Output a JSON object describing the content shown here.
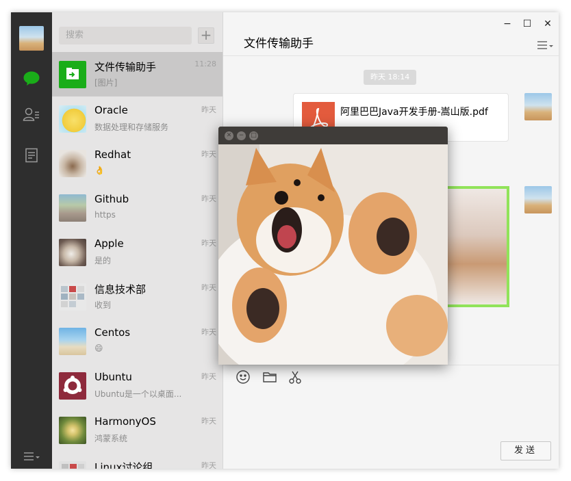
{
  "search": {
    "placeholder": "搜索"
  },
  "plus_label": "+",
  "chats": [
    {
      "name": "文件传输助手",
      "time": "11:28",
      "preview": "[图片]"
    },
    {
      "name": "Oracle",
      "time": "昨天",
      "preview": "数据处理和存储服务"
    },
    {
      "name": "Redhat",
      "time": "昨天",
      "preview": "👌"
    },
    {
      "name": "Github",
      "time": "昨天",
      "preview": "https"
    },
    {
      "name": "Apple",
      "time": "昨天",
      "preview": "是的"
    },
    {
      "name": "信息技术部",
      "time": "昨天",
      "preview": "收到"
    },
    {
      "name": "Centos",
      "time": "昨天",
      "preview": "😄"
    },
    {
      "name": "Ubuntu",
      "time": "昨天",
      "preview": "Ubuntu是一个以桌面..."
    },
    {
      "name": "HarmonyOS",
      "time": "昨天",
      "preview": "鸿蒙系统"
    },
    {
      "name": "Linux讨论组",
      "time": "昨天",
      "preview": ""
    }
  ],
  "conversation": {
    "title": "文件传输助手",
    "time_divider": "昨天 18:14",
    "file_name": "阿里巴巴Java开发手册-嵩山版.pdf"
  },
  "window_controls": {
    "minimize": "−",
    "maximize": "☐",
    "close": "✕"
  },
  "send_label": "发送",
  "colors": {
    "accent": "#1aad19",
    "sidebar": "#2e2e2e",
    "pdf": "#e35b3d",
    "image_border": "#91e35a"
  }
}
